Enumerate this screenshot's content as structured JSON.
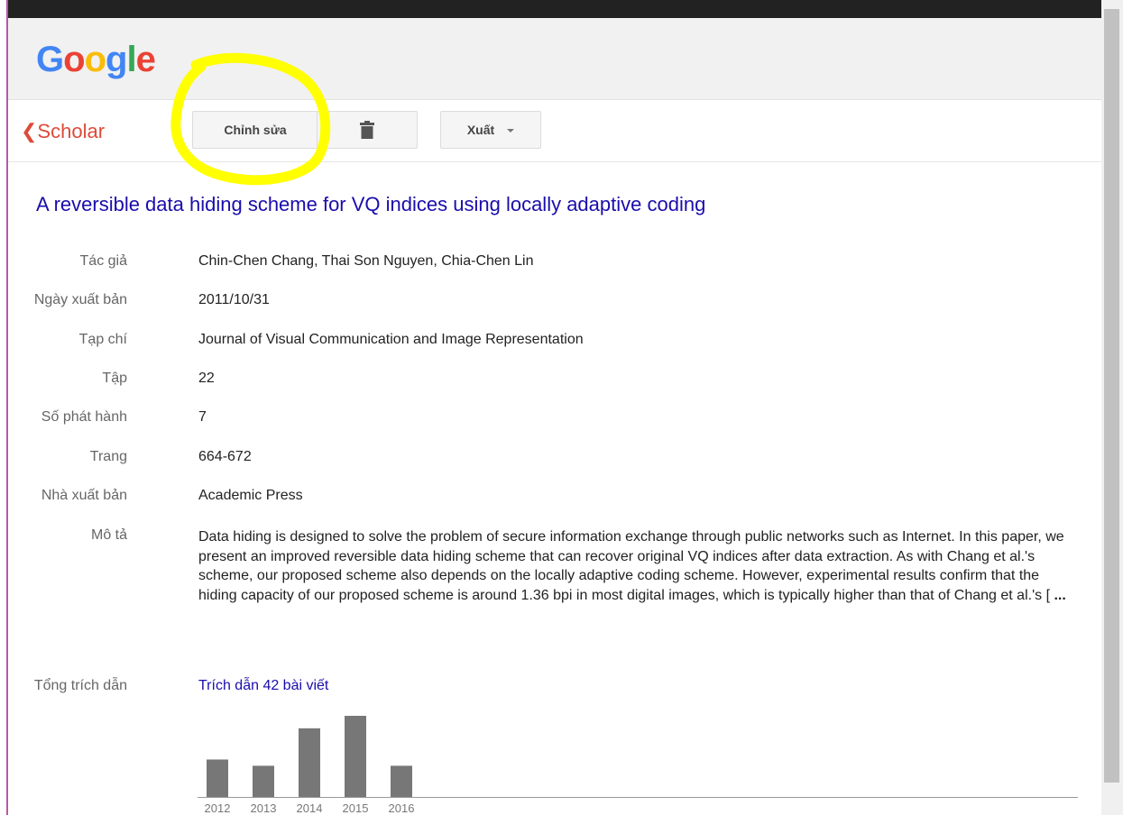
{
  "header": {
    "logo_letters": [
      {
        "ch": "G",
        "color": "#4285f4"
      },
      {
        "ch": "o",
        "color": "#ea4335"
      },
      {
        "ch": "o",
        "color": "#fbbc05"
      },
      {
        "ch": "g",
        "color": "#4285f4"
      },
      {
        "ch": "l",
        "color": "#34a853"
      },
      {
        "ch": "e",
        "color": "#ea4335"
      }
    ]
  },
  "toolbar": {
    "back_label": "❮Scholar",
    "edit_label": "Chỉnh sửa",
    "delete_icon": "trash-icon",
    "export_label": "Xuất"
  },
  "article": {
    "title": "A reversible data hiding scheme for VQ indices using locally adaptive coding",
    "fields": [
      {
        "label": "Tác giả",
        "value": "Chin-Chen Chang, Thai Son Nguyen, Chia-Chen Lin"
      },
      {
        "label": "Ngày xuất bản",
        "value": "2011/10/31"
      },
      {
        "label": "Tạp chí",
        "value": "Journal of Visual Communication and Image Representation"
      },
      {
        "label": "Tập",
        "value": "22"
      },
      {
        "label": "Số phát hành",
        "value": "7"
      },
      {
        "label": "Trang",
        "value": "664-672"
      },
      {
        "label": "Nhà xuất bản",
        "value": "Academic Press"
      }
    ],
    "description_label": "Mô tả",
    "description": "Data hiding is designed to solve the problem of secure information exchange through public networks such as Internet. In this paper, we present an improved reversible data hiding scheme that can recover original VQ indices after data extraction. As with Chang et al.'s scheme, our proposed scheme also depends on the locally adaptive coding scheme. However, experimental results confirm that the hiding capacity of our proposed scheme is around 1.36 bpi in most digital images, which is typically higher than that of Chang et al.'s [",
    "description_more": " ...",
    "citations_label": "Tổng trích dẫn",
    "citations_link": "Trích dẫn 42 bài viết"
  },
  "colors": {
    "accent_red": "#dd4b39",
    "link_blue": "#1a0dab",
    "bar": "#777777",
    "highlight": "#ffff00"
  },
  "chart_data": {
    "type": "bar",
    "categories": [
      "2012",
      "2013",
      "2014",
      "2015",
      "2016"
    ],
    "values": [
      6,
      5,
      11,
      13,
      5
    ],
    "ylim": [
      0,
      13
    ],
    "grid": false
  }
}
